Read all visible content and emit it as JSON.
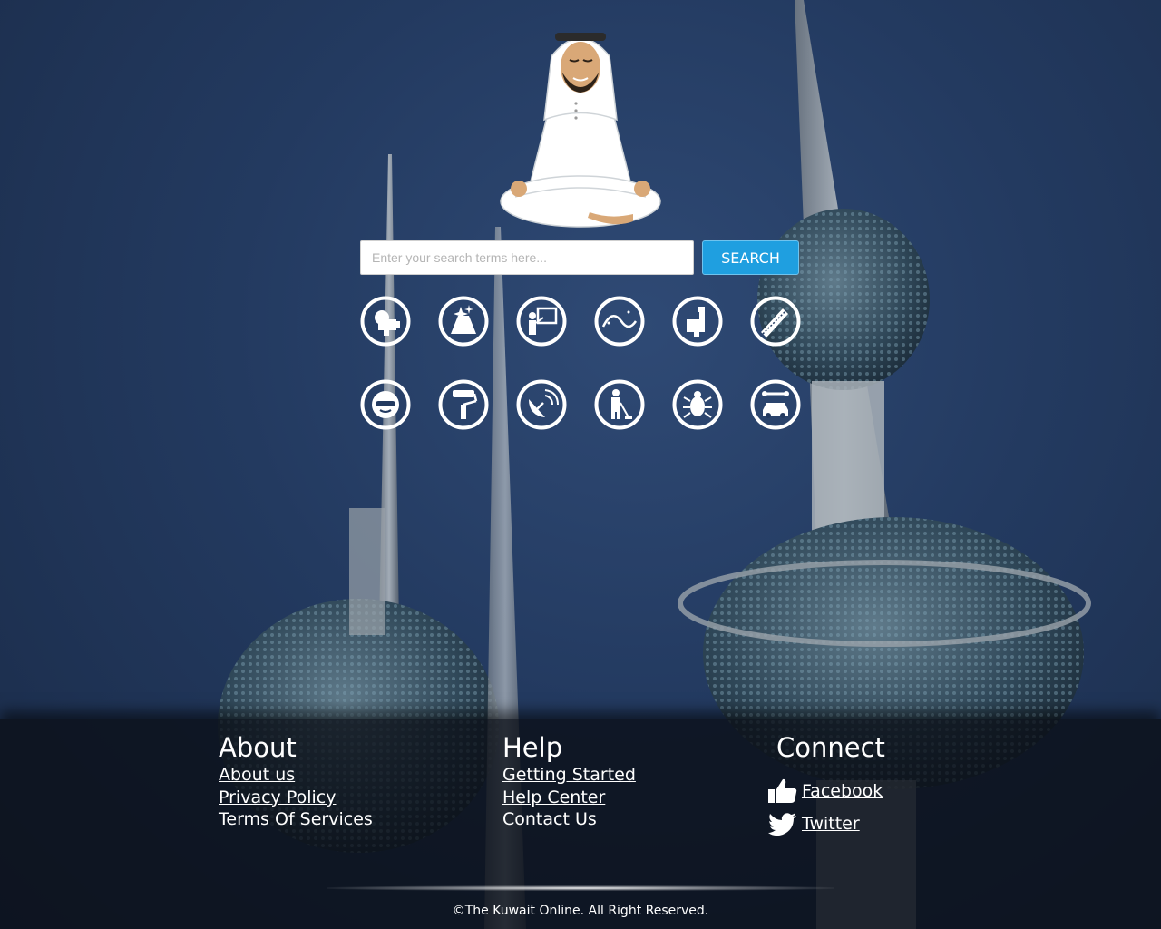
{
  "search": {
    "placeholder": "Enter your search terms here...",
    "value": "",
    "button_label": "SEARCH"
  },
  "categories": [
    "cctv-icon",
    "cleaning-icon",
    "teaching-icon",
    "satellite-signal-icon",
    "plumbing-icon",
    "carpentry-saw-icon",
    "welding-mask-icon",
    "painting-roller-icon",
    "satellite-dish-icon",
    "vacuum-cleaning-icon",
    "pest-control-icon",
    "car-repair-icon"
  ],
  "footer": {
    "about": {
      "heading": "About",
      "links": [
        "About us",
        "Privacy Policy",
        "Terms Of Services"
      ]
    },
    "help": {
      "heading": "Help",
      "links": [
        "Getting Started",
        "Help Center",
        "Contact Us"
      ]
    },
    "connect": {
      "heading": "Connect",
      "links": [
        {
          "label": "Facebook",
          "icon": "thumbs-up-icon"
        },
        {
          "label": "Twitter",
          "icon": "twitter-bird-icon"
        }
      ]
    },
    "copyright": "©The Kuwait Online. All Right Reserved."
  },
  "colors": {
    "accent": "#1f9fe0",
    "background": "#233a60",
    "footer": "#0a0e16"
  }
}
